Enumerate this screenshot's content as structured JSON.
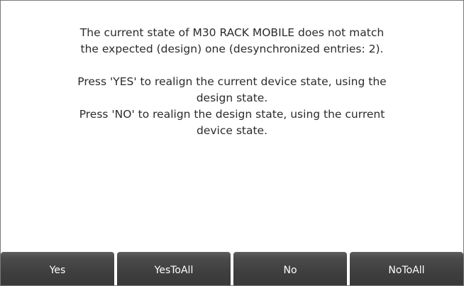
{
  "dialog": {
    "message_lines": [
      "The current state of M30 RACK MOBILE does not match",
      "the expected (design) one (desynchronized entries: 2).",
      "",
      "Press 'YES' to realign the current device state, using the",
      "design state.",
      "Press 'NO' to realign the design state, using the current",
      "device state."
    ]
  },
  "buttons": {
    "yes": "Yes",
    "yes_to_all": "YesToAll",
    "no": "No",
    "no_to_all": "NoToAll"
  },
  "colors": {
    "button_bg": "#3f3f3f",
    "button_text": "#ffffff",
    "message_text": "#2b2b2b",
    "border": "#7a7a7a"
  }
}
